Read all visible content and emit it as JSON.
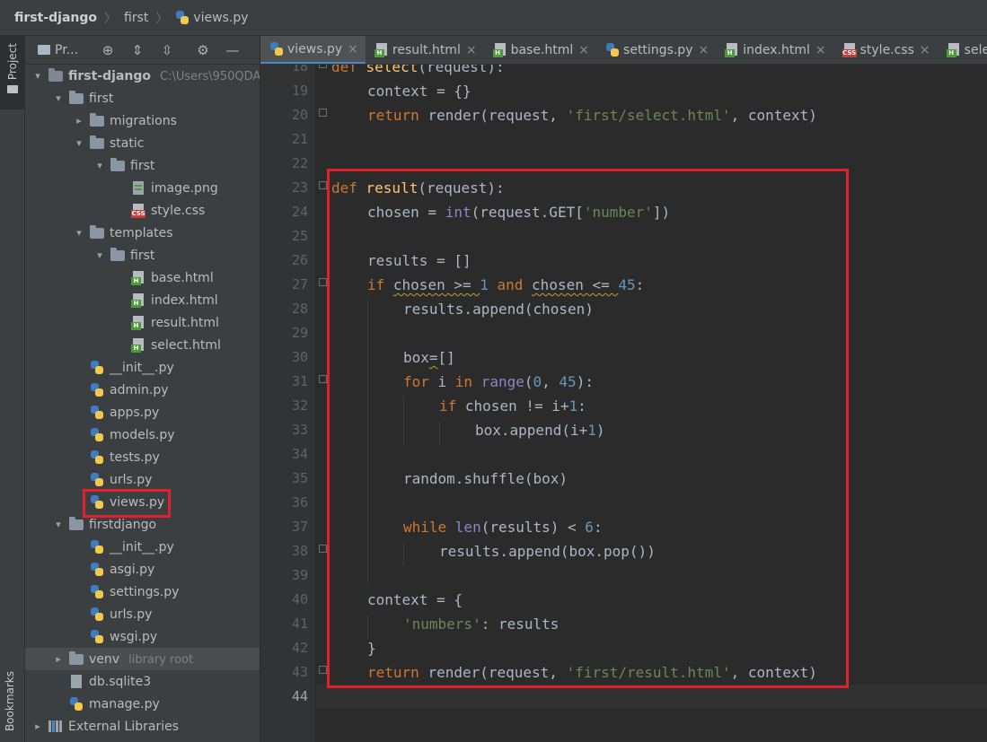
{
  "breadcrumb": [
    "first-django",
    "first",
    "views.py"
  ],
  "stripe": {
    "project_label": "Project",
    "bookmarks_label": "Bookmarks"
  },
  "panel": {
    "title": "Pr...",
    "icons": [
      "target-icon",
      "expand-all-icon",
      "collapse-all-icon",
      "gear-icon",
      "minimize-icon"
    ]
  },
  "tree": [
    {
      "label": "first-django",
      "hint": "C:\\Users\\950QDA",
      "bold": true
    },
    {
      "label": "first"
    },
    {
      "label": "migrations"
    },
    {
      "label": "static"
    },
    {
      "label": "first"
    },
    {
      "label": "image.png"
    },
    {
      "label": "style.css"
    },
    {
      "label": "templates"
    },
    {
      "label": "first"
    },
    {
      "label": "base.html"
    },
    {
      "label": "index.html"
    },
    {
      "label": "result.html"
    },
    {
      "label": "select.html"
    },
    {
      "label": "__init__.py"
    },
    {
      "label": "admin.py"
    },
    {
      "label": "apps.py"
    },
    {
      "label": "models.py"
    },
    {
      "label": "tests.py"
    },
    {
      "label": "urls.py"
    },
    {
      "label": "views.py"
    },
    {
      "label": "firstdjango"
    },
    {
      "label": "__init__.py"
    },
    {
      "label": "asgi.py"
    },
    {
      "label": "settings.py"
    },
    {
      "label": "urls.py"
    },
    {
      "label": "wsgi.py"
    },
    {
      "label": "venv",
      "hint": "library root"
    },
    {
      "label": "db.sqlite3"
    },
    {
      "label": "manage.py"
    },
    {
      "label": "External Libraries"
    }
  ],
  "tabs": [
    {
      "label": "views.py",
      "active": true
    },
    {
      "label": "result.html"
    },
    {
      "label": "base.html"
    },
    {
      "label": "settings.py"
    },
    {
      "label": "index.html"
    },
    {
      "label": "style.css"
    },
    {
      "label": "select.html"
    }
  ],
  "line_numbers": [
    "18",
    "19",
    "20",
    "21",
    "22",
    "23",
    "24",
    "25",
    "26",
    "27",
    "28",
    "29",
    "30",
    "31",
    "32",
    "33",
    "34",
    "35",
    "36",
    "37",
    "38",
    "39",
    "40",
    "41",
    "42",
    "43",
    "44"
  ],
  "code": {
    "l18": {
      "a": "def ",
      "b": "select",
      "c": "(request):"
    },
    "l19": {
      "a": "context = {}"
    },
    "l20": {
      "a": "return ",
      "b": "render(request, ",
      "c": "'first/select.html'",
      "d": ", context)"
    },
    "l23": {
      "a": "def ",
      "b": "result",
      "c": "(request):"
    },
    "l24": {
      "a": "chosen = ",
      "b": "int",
      "c": "(request.GET[",
      "d": "'number'",
      "e": "])"
    },
    "l26": {
      "a": "results = []"
    },
    "l27": {
      "a": "if ",
      "b": "chosen >= ",
      "c": "1",
      "d": " and ",
      "e": "chosen <= ",
      "f": "45",
      "g": ":"
    },
    "l28": {
      "a": "results.append(chosen)"
    },
    "l30": {
      "a": "box",
      "b": "=",
      "c": "[]"
    },
    "l31": {
      "a": "for ",
      "b": "i ",
      "c": "in ",
      "d": "range",
      "e": "(",
      "f": "0",
      "g": ", ",
      "h": "45",
      "i": "):"
    },
    "l32": {
      "a": "if ",
      "b": "chosen != i+",
      "c": "1",
      "d": ":"
    },
    "l33": {
      "a": "box.append(i+",
      "b": "1",
      "c": ")"
    },
    "l35": {
      "a": "random.shuffle(box)"
    },
    "l37": {
      "a": "while ",
      "b": "len",
      "c": "(results) < ",
      "d": "6",
      "e": ":"
    },
    "l38": {
      "a": "results.append(box.pop())"
    },
    "l40": {
      "a": "context = {"
    },
    "l41": {
      "a": "'numbers'",
      "b": ": results"
    },
    "l42": {
      "a": "}"
    },
    "l43": {
      "a": "return ",
      "b": "render(request, ",
      "c": "'first/result.html'",
      "d": ", context)"
    }
  },
  "colors": {
    "highlight_box": "#e0202a",
    "keyword": "#cc7832",
    "function": "#ffc66d",
    "string": "#6a8759",
    "number": "#6897bb",
    "builtin": "#8888c6"
  }
}
